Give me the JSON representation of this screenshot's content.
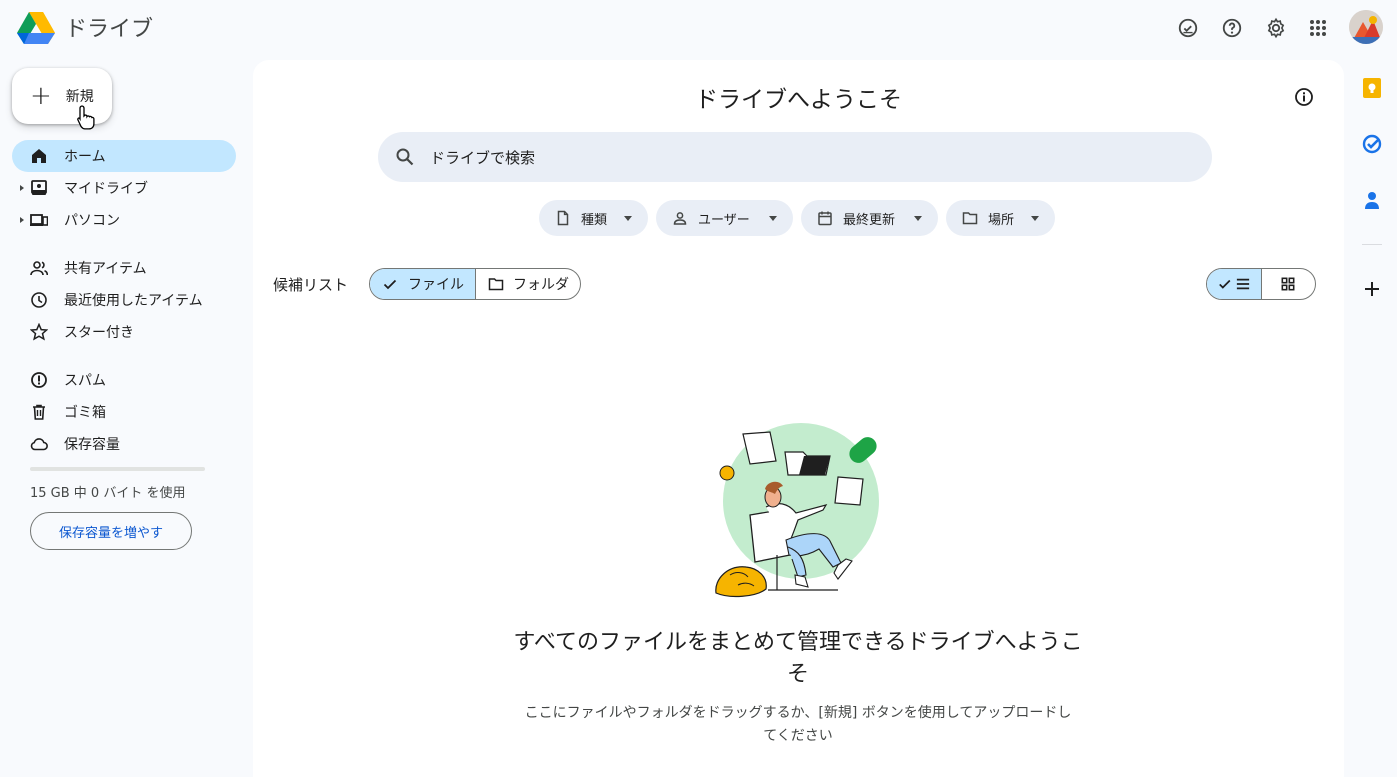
{
  "app": {
    "title": "ドライブ"
  },
  "sidebar": {
    "new_label": "新規",
    "items": [
      {
        "label": "ホーム",
        "icon": "home-icon",
        "active": true
      },
      {
        "label": "マイドライブ",
        "icon": "my-drive-icon",
        "expandable": true
      },
      {
        "label": "パソコン",
        "icon": "computers-icon",
        "expandable": true
      },
      {
        "label": "共有アイテム",
        "icon": "shared-icon"
      },
      {
        "label": "最近使用したアイテム",
        "icon": "recent-icon"
      },
      {
        "label": "スター付き",
        "icon": "star-icon"
      },
      {
        "label": "スパム",
        "icon": "spam-icon"
      },
      {
        "label": "ゴミ箱",
        "icon": "trash-icon"
      },
      {
        "label": "保存容量",
        "icon": "cloud-icon"
      }
    ],
    "storage_text": "15 GB 中 0 バイト を使用",
    "storage_fraction": 0,
    "storage_button": "保存容量を増やす"
  },
  "main": {
    "welcome_title": "ドライブへようこそ",
    "search_placeholder": "ドライブで検索",
    "filters": [
      {
        "label": "種類",
        "icon": "file-icon"
      },
      {
        "label": "ユーザー",
        "icon": "person-icon"
      },
      {
        "label": "最終更新",
        "icon": "calendar-icon"
      },
      {
        "label": "場所",
        "icon": "folder-icon"
      }
    ],
    "suggested_label": "候補リスト",
    "toggle": {
      "files": "ファイル",
      "folders": "フォルダ",
      "selected": "files"
    },
    "view": {
      "selected": "list"
    },
    "empty_title": "すべてのファイルをまとめて管理できるドライブへようこそ",
    "empty_desc": "ここにファイルやフォルダをドラッグするか、[新規] ボタンを使用してアップロードしてください"
  },
  "colors": {
    "accent": "#c2e7ff",
    "link": "#0b57d0",
    "background": "#f8fafd"
  }
}
